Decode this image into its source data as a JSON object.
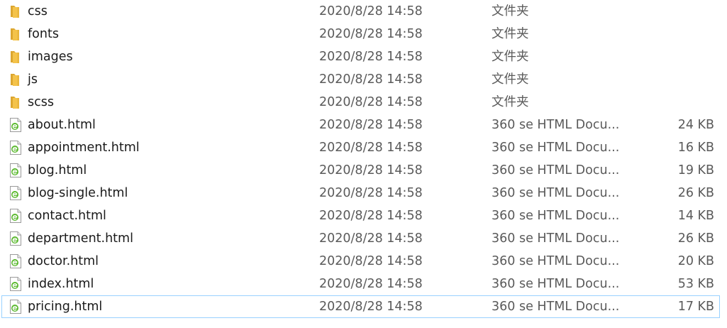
{
  "files": [
    {
      "name": "css",
      "date": "2020/8/28 14:58",
      "type": "文件夹",
      "size": "",
      "icon": "folder-icon"
    },
    {
      "name": "fonts",
      "date": "2020/8/28 14:58",
      "type": "文件夹",
      "size": "",
      "icon": "folder-icon"
    },
    {
      "name": "images",
      "date": "2020/8/28 14:58",
      "type": "文件夹",
      "size": "",
      "icon": "folder-icon"
    },
    {
      "name": "js",
      "date": "2020/8/28 14:58",
      "type": "文件夹",
      "size": "",
      "icon": "folder-icon"
    },
    {
      "name": "scss",
      "date": "2020/8/28 14:58",
      "type": "文件夹",
      "size": "",
      "icon": "folder-icon"
    },
    {
      "name": "about.html",
      "date": "2020/8/28 14:58",
      "type": "360 se HTML Docu...",
      "size": "24 KB",
      "icon": "html-document-icon"
    },
    {
      "name": "appointment.html",
      "date": "2020/8/28 14:58",
      "type": "360 se HTML Docu...",
      "size": "16 KB",
      "icon": "html-document-icon"
    },
    {
      "name": "blog.html",
      "date": "2020/8/28 14:58",
      "type": "360 se HTML Docu...",
      "size": "19 KB",
      "icon": "html-document-icon"
    },
    {
      "name": "blog-single.html",
      "date": "2020/8/28 14:58",
      "type": "360 se HTML Docu...",
      "size": "26 KB",
      "icon": "html-document-icon"
    },
    {
      "name": "contact.html",
      "date": "2020/8/28 14:58",
      "type": "360 se HTML Docu...",
      "size": "14 KB",
      "icon": "html-document-icon"
    },
    {
      "name": "department.html",
      "date": "2020/8/28 14:58",
      "type": "360 se HTML Docu...",
      "size": "26 KB",
      "icon": "html-document-icon"
    },
    {
      "name": "doctor.html",
      "date": "2020/8/28 14:58",
      "type": "360 se HTML Docu...",
      "size": "20 KB",
      "icon": "html-document-icon"
    },
    {
      "name": "index.html",
      "date": "2020/8/28 14:58",
      "type": "360 se HTML Docu...",
      "size": "53 KB",
      "icon": "html-document-icon"
    },
    {
      "name": "pricing.html",
      "date": "2020/8/28 14:58",
      "type": "360 se HTML Docu...",
      "size": "17 KB",
      "icon": "html-document-icon",
      "selected": true
    }
  ],
  "colors": {
    "folder_icon": "#f4c34a",
    "folder_icon_dark": "#dca630",
    "html_icon_green": "#57b72a",
    "selection_border": "#99d1ff"
  }
}
